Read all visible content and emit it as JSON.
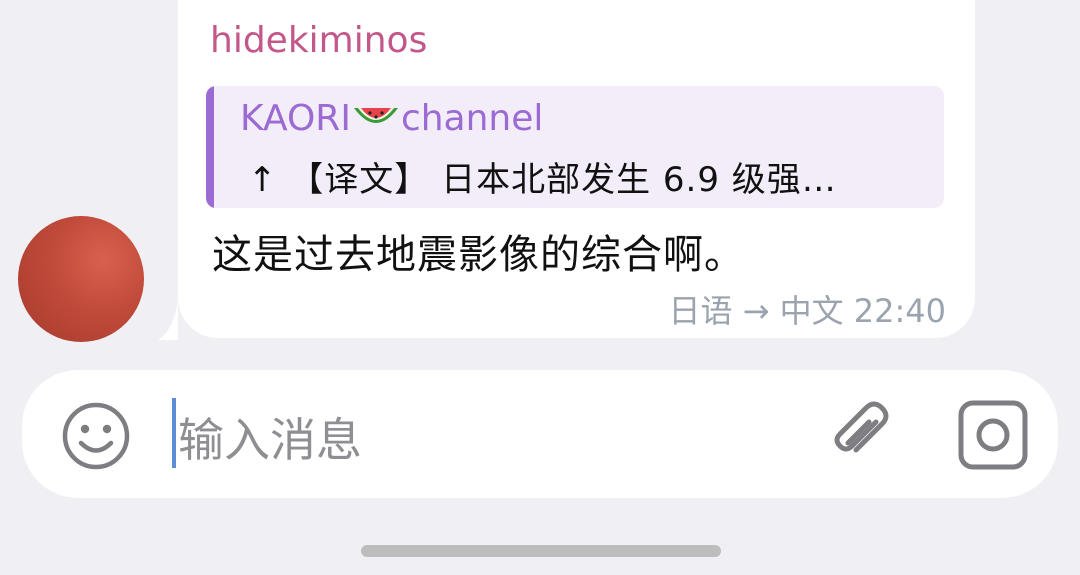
{
  "message": {
    "sender": "hidekiminos",
    "reply": {
      "channel_name_before": "KAORI",
      "channel_emoji": "watermelon-icon",
      "channel_name_after": "channel",
      "preview": "↑ 【译文】 日本北部发生 6.9 级强…"
    },
    "text": "这是过去地震影像的综合啊。",
    "translation": "日语 → 中文",
    "time": "22:40"
  },
  "composer": {
    "placeholder": "输入消息",
    "icons": [
      "smiley-icon",
      "paperclip-icon",
      "camera-icon"
    ]
  },
  "colors": {
    "sender": "#c3578a",
    "reply_accent": "#9b6ad2",
    "reply_bg": "#f3edf9",
    "meta": "#9aa3ae",
    "caret": "#5b8ed6"
  }
}
